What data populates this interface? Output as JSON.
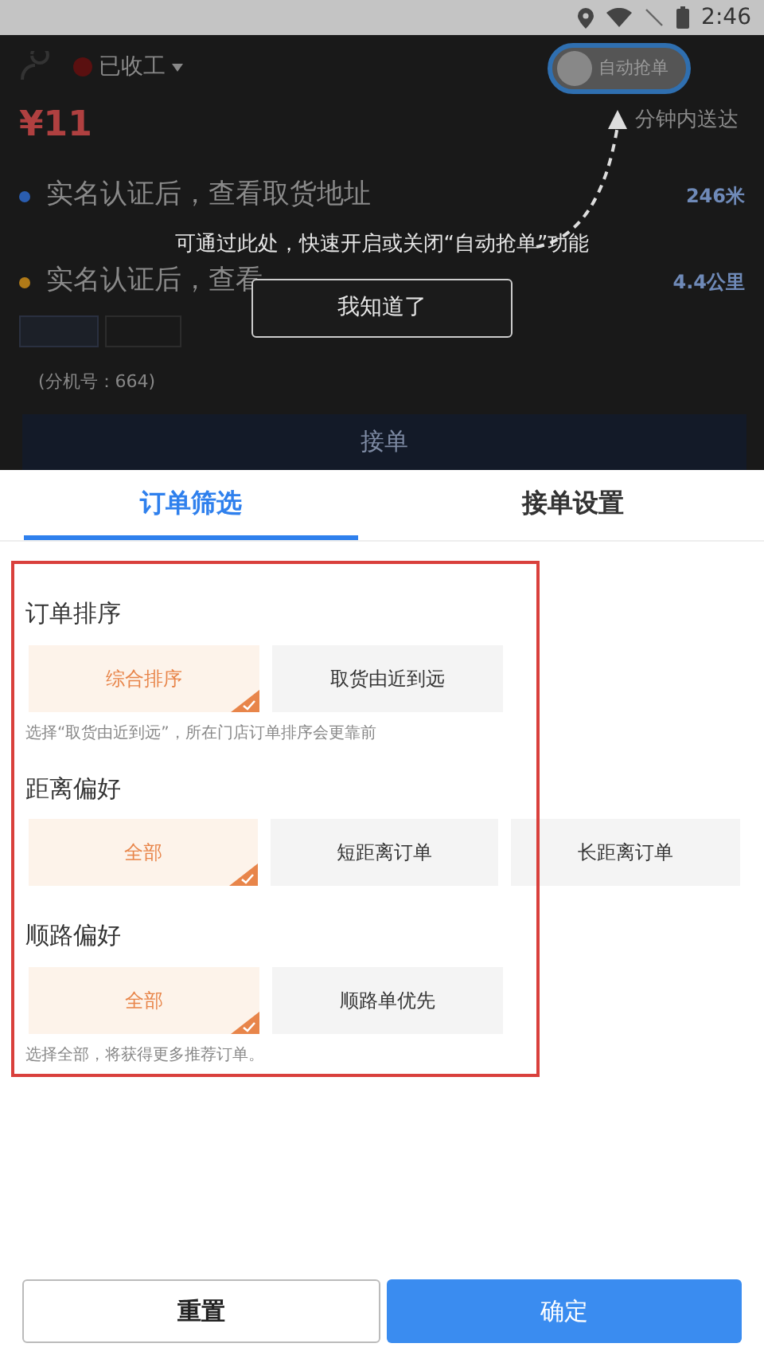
{
  "status_bar": {
    "time": "2:46"
  },
  "background": {
    "work_status": "已收工",
    "auto_grab": {
      "label": "自动抢单",
      "on": false
    },
    "price": "¥11",
    "delivery": "分钟内送达",
    "orders": [
      {
        "address": "实名认证后，查看取货地址",
        "distance": "246米",
        "color": "#2a5db0"
      },
      {
        "address": "实名认证后，查看",
        "distance": "4.4公里",
        "color": "#b07a18"
      }
    ],
    "extension": "(分机号：664)",
    "accept_button": "接单"
  },
  "guide": {
    "message": "可通过此处，快速开启或关闭“自动抢单”功能",
    "button": "我知道了"
  },
  "tabs": [
    {
      "label": "订单筛选",
      "selected": true
    },
    {
      "label": "接单设置",
      "selected": false
    }
  ],
  "sections": [
    {
      "title": "订单排序",
      "options": [
        {
          "label": "综合排序",
          "selected": true
        },
        {
          "label": "取货由近到远",
          "selected": false
        }
      ],
      "hint": "选择“取货由近到远”，所在门店订单排序会更靠前"
    },
    {
      "title": "距离偏好",
      "options": [
        {
          "label": "全部",
          "selected": true
        },
        {
          "label": "短距离订单",
          "selected": false
        },
        {
          "label": "长距离订单",
          "selected": false
        }
      ]
    },
    {
      "title": "顺路偏好",
      "options": [
        {
          "label": "全部",
          "selected": true
        },
        {
          "label": "顺路单优先",
          "selected": false
        }
      ],
      "hint": "选择全部，将获得更多推荐订单。"
    }
  ],
  "footer": {
    "reset_button": "重置",
    "confirm_button": "确定"
  }
}
